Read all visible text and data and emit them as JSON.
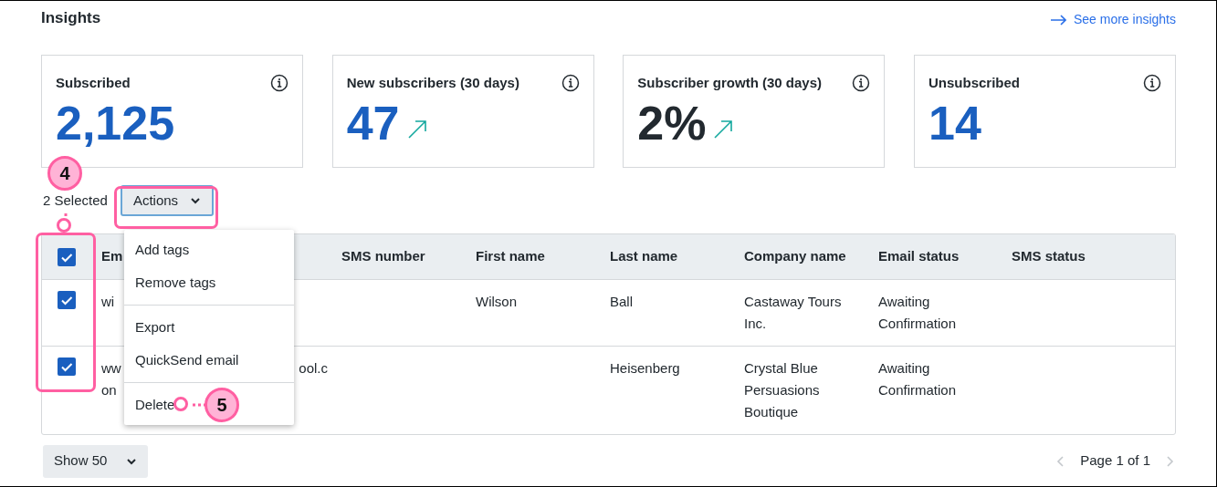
{
  "header": {
    "title": "Insights",
    "link": "See more insights"
  },
  "stats": [
    {
      "label": "Subscribed",
      "value": "2,125",
      "color": "#1a5fbf",
      "trend_up": false
    },
    {
      "label": "New subscribers (30 days)",
      "value": "47",
      "color": "#1a5fbf",
      "trend_up": true
    },
    {
      "label": "Subscriber growth (30 days)",
      "value": "2%",
      "color": "#22292f",
      "trend_up": true
    },
    {
      "label": "Unsubscribed",
      "value": "14",
      "color": "#1a5fbf",
      "trend_up": false
    }
  ],
  "selection": {
    "count_text": "2 Selected",
    "actions_button": "Actions"
  },
  "actions_menu": {
    "groups": [
      [
        "Add tags",
        "Remove tags"
      ],
      [
        "Export",
        "QuickSend email"
      ],
      [
        "Delete"
      ]
    ]
  },
  "table": {
    "select_all_checked": true,
    "columns": [
      "Em",
      "SMS number",
      "First name",
      "Last name",
      "Company name",
      "Email status",
      "SMS status"
    ],
    "rows": [
      {
        "checked": true,
        "email": {
          "line_1": "wi"
        },
        "first_name": "Wilson",
        "last_name": "Ball",
        "company_name": "Castaway Tours Inc.",
        "email_status": "Awaiting Confirmation"
      },
      {
        "checked": true,
        "email": {
          "line_1": "ww",
          "line_1_tail": "ool.c",
          "line_2": "on"
        },
        "last_name": "Heisenberg",
        "company_name": "Crystal Blue Persuasions Boutique",
        "email_status": "Awaiting Confirmation"
      }
    ]
  },
  "footer": {
    "page_size": "Show 50",
    "page_text": "Page 1 of 1",
    "prev_disabled": true,
    "next_disabled": true
  },
  "annotations": [
    {
      "number": "4"
    },
    {
      "number": "5"
    }
  ]
}
